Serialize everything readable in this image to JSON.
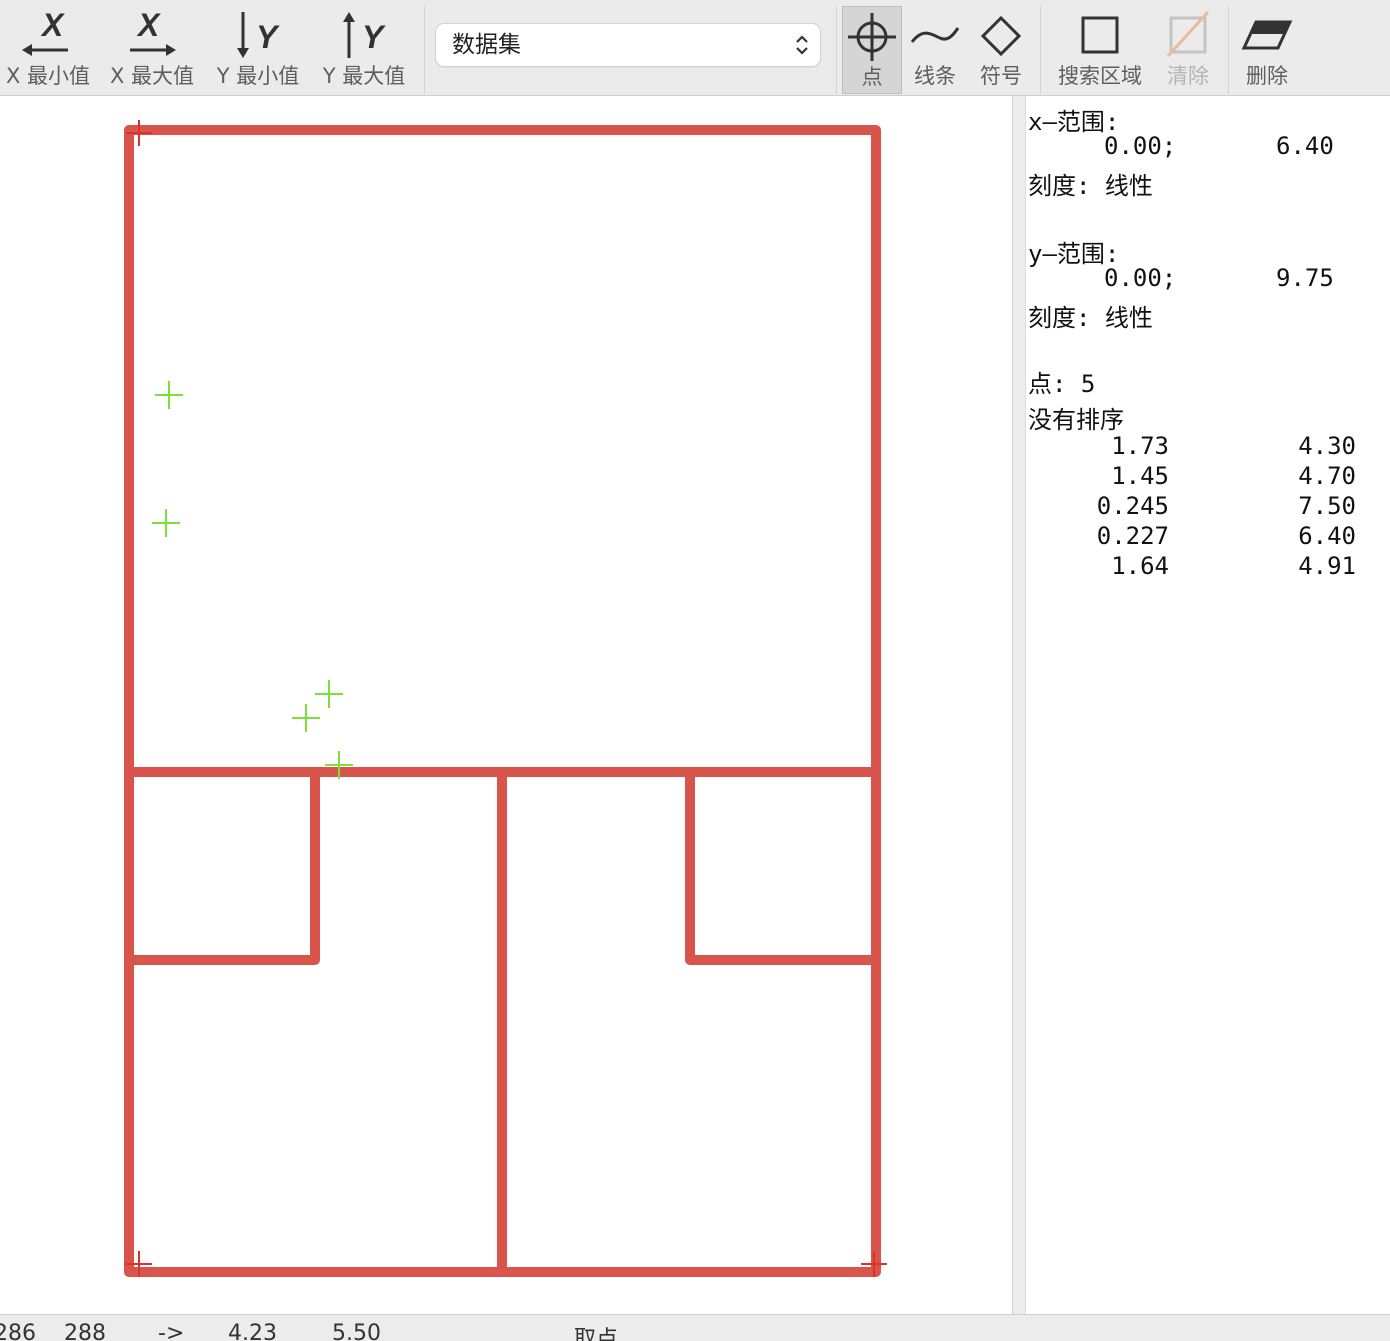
{
  "toolbar": {
    "x_min_label": "X 最小值",
    "x_max_label": "X 最大值",
    "y_min_label": "Y 最小值",
    "y_max_label": "Y 最大值",
    "dataset_value": "数据集",
    "point_label": "点",
    "line_label": "线条",
    "symbol_label": "符号",
    "search_area_label": "搜索区域",
    "clear_label": "清除",
    "delete_label": "删除"
  },
  "info": {
    "x_range_label": "x–范围:",
    "x_min": "0.00;",
    "x_max": "6.40",
    "x_scale": "刻度: 线性",
    "y_range_label": "y–范围:",
    "y_min": "0.00;",
    "y_max": "9.75",
    "y_scale": "刻度: 线性",
    "points_count": "点: 5",
    "sort_status": "没有排序",
    "points": [
      {
        "x": "1.73",
        "y": "4.30"
      },
      {
        "x": "1.45",
        "y": "4.70"
      },
      {
        "x": "0.245",
        "y": "7.50"
      },
      {
        "x": "0.227",
        "y": "6.40"
      },
      {
        "x": "1.64",
        "y": "4.91"
      }
    ]
  },
  "status": {
    "pixel_x": "286",
    "pixel_y": "288",
    "arrow": "->",
    "value_x": "4.23",
    "value_y": "5.50",
    "mode": "取点"
  },
  "colors": {
    "frame": "#d9544a",
    "marker": "#7de03a",
    "axis_marker": "#e0302a"
  },
  "icons": [
    "x-min-icon",
    "x-max-icon",
    "y-min-icon",
    "y-max-icon",
    "crosshair-icon",
    "wave-icon",
    "diamond-icon",
    "square-icon",
    "clear-icon",
    "eraser-icon",
    "chevron-updown-icon"
  ]
}
